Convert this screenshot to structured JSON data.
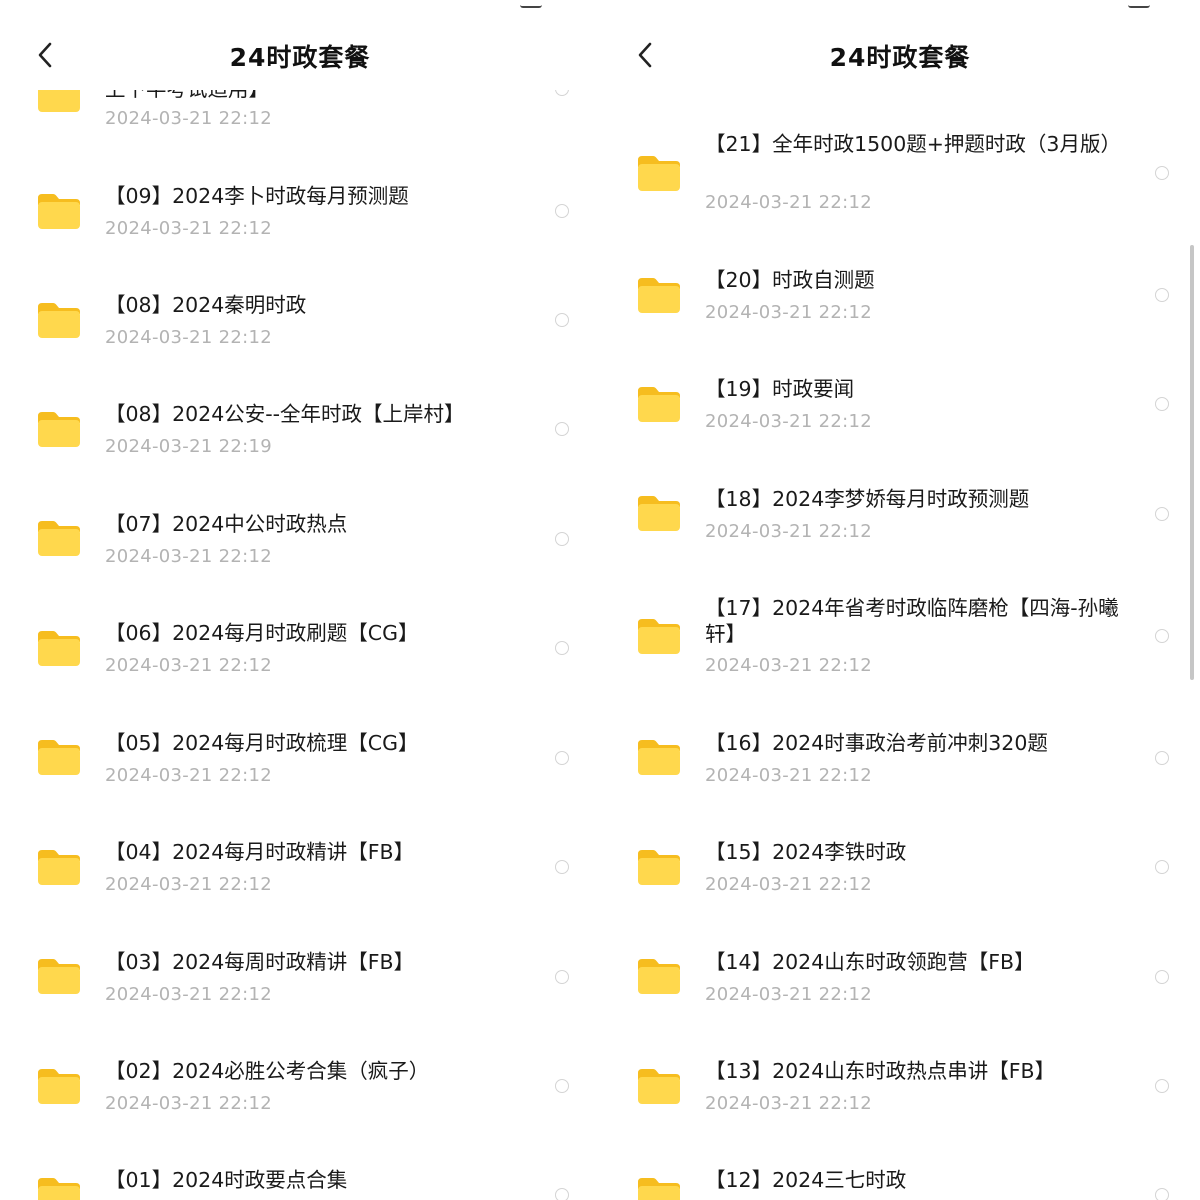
{
  "left_screen": {
    "header": {
      "title": "24时政套餐"
    },
    "items": [
      {
        "name": "上下半考试适用】",
        "date": "2024-03-21 22:12"
      },
      {
        "name": "【09】2024李卜时政每月预测题",
        "date": "2024-03-21 22:12"
      },
      {
        "name": "【08】2024秦明时政",
        "date": "2024-03-21 22:12"
      },
      {
        "name": "【08】2024公安--全年时政【上岸村】",
        "date": "2024-03-21 22:19"
      },
      {
        "name": "【07】2024中公时政热点",
        "date": "2024-03-21 22:12"
      },
      {
        "name": "【06】2024每月时政刷题【CG】",
        "date": "2024-03-21 22:12"
      },
      {
        "name": "【05】2024每月时政梳理【CG】",
        "date": "2024-03-21 22:12"
      },
      {
        "name": "【04】2024每月时政精讲【FB】",
        "date": "2024-03-21 22:12"
      },
      {
        "name": "【03】2024每周时政精讲【FB】",
        "date": "2024-03-21 22:12"
      },
      {
        "name": "【02】2024必胜公考合集（疯子）",
        "date": "2024-03-21 22:12"
      },
      {
        "name": "【01】2024时政要点合集",
        "date": ""
      }
    ]
  },
  "right_screen": {
    "header": {
      "title": "24时政套餐"
    },
    "items": [
      {
        "name": "【21】全年时政1500题+押题时政（3月版）",
        "date": "2024-03-21 22:12"
      },
      {
        "name": "【20】时政自测题",
        "date": "2024-03-21 22:12"
      },
      {
        "name": "【19】时政要闻",
        "date": "2024-03-21 22:12"
      },
      {
        "name": "【18】2024李梦娇每月时政预测题",
        "date": "2024-03-21 22:12"
      },
      {
        "name": "【17】2024年省考时政临阵磨枪【四海-孙曦轩】",
        "date": "2024-03-21 22:12"
      },
      {
        "name": "【16】2024时事政治考前冲刺320题",
        "date": "2024-03-21 22:12"
      },
      {
        "name": "【15】2024李铁时政",
        "date": "2024-03-21 22:12"
      },
      {
        "name": "【14】2024山东时政领跑营【FB】",
        "date": "2024-03-21 22:12"
      },
      {
        "name": "【13】2024山东时政热点串讲【FB】",
        "date": "2024-03-21 22:12"
      },
      {
        "name": "【12】2024三七时政",
        "date": ""
      }
    ]
  },
  "colors": {
    "folder_body": "#FFD84D",
    "folder_tab": "#F6BD1F",
    "date_text": "#b3b3b3",
    "radio_border": "#d4d4d4"
  },
  "icons": {
    "back": "chevron-left-icon",
    "folder": "folder-icon",
    "select": "radio-circle-icon"
  }
}
